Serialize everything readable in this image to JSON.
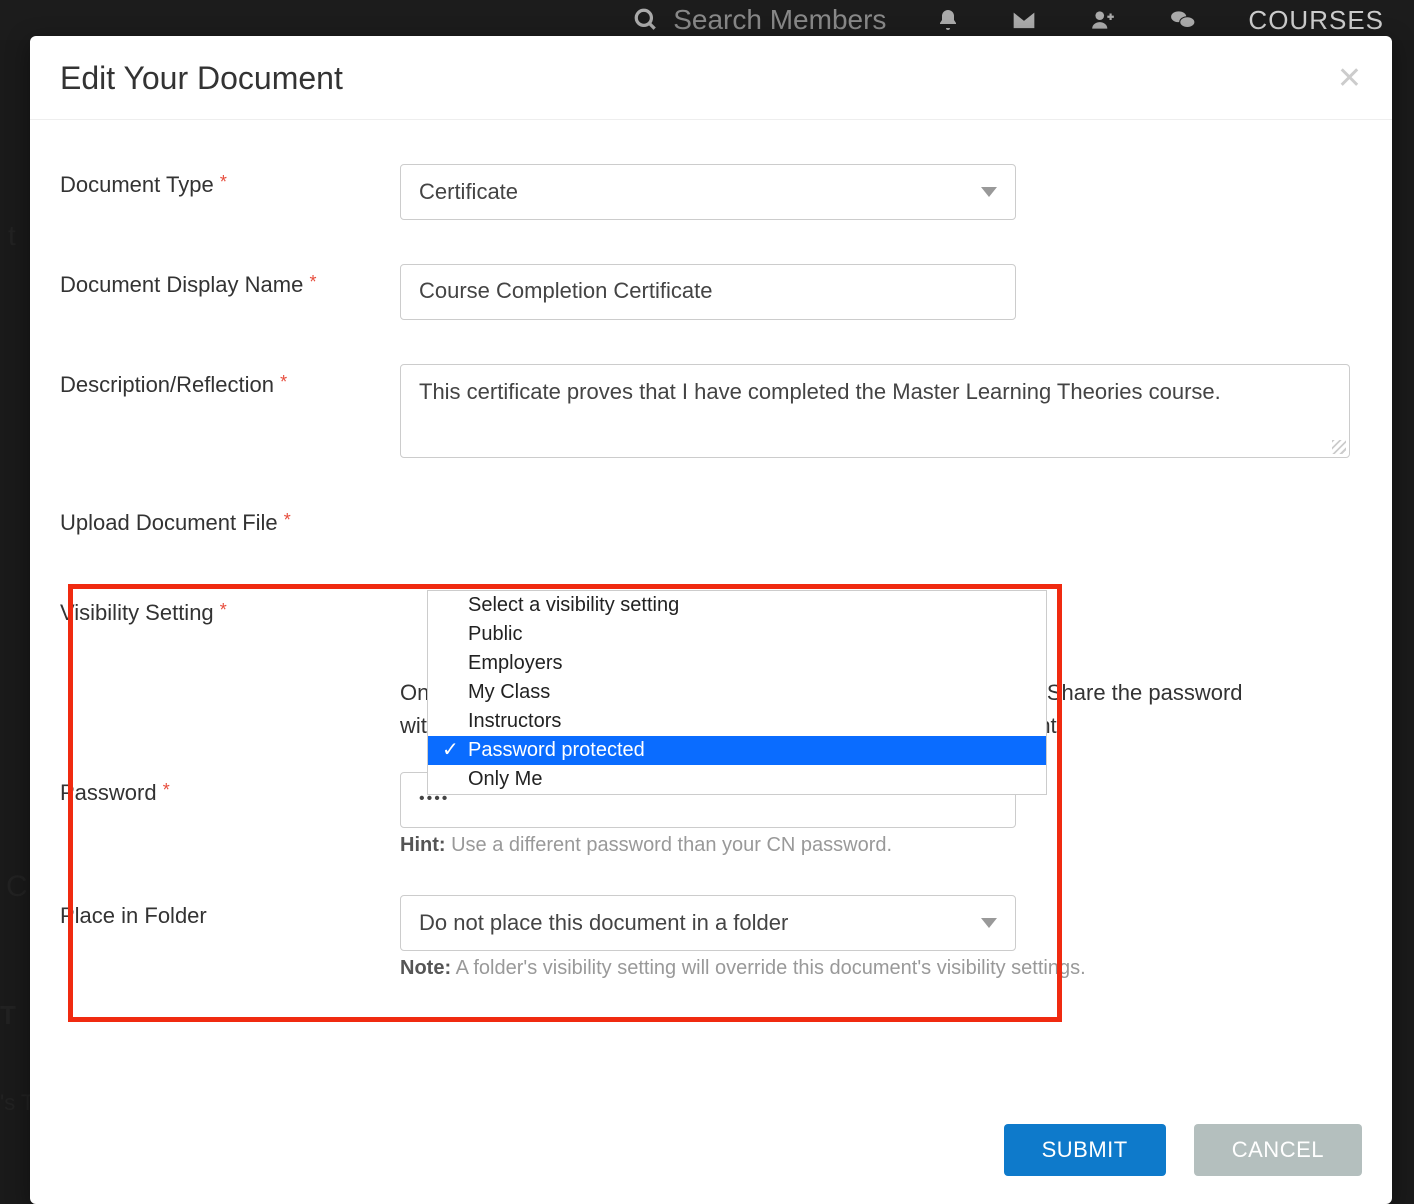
{
  "topnav": {
    "search_placeholder": "Search Members",
    "courses_label": "COURSES"
  },
  "modal": {
    "title": "Edit Your Document"
  },
  "form": {
    "doc_type": {
      "label": "Document Type",
      "value": "Certificate"
    },
    "display_name": {
      "label": "Document Display Name",
      "value": "Course Completion Certificate"
    },
    "description": {
      "label": "Description/Reflection",
      "value": "This certificate proves that I have completed the Master Learning Theories course."
    },
    "upload": {
      "label": "Upload Document File"
    },
    "visibility": {
      "label": "Visibility Setting",
      "options": [
        "Select a visibility setting",
        "Public",
        "Employers",
        "My Class",
        "Instructors",
        "Password protected",
        "Only Me"
      ],
      "selected_index": 5,
      "description": "Only users, with the password will be able to view your document. Share the password with people you would like to give permission to view this document."
    },
    "password": {
      "label": "Password",
      "value": "••••",
      "hint_label": "Hint:",
      "hint_text": "Use a different password than your CN password."
    },
    "folder": {
      "label": "Place in Folder",
      "value": "Do not place this document in a folder",
      "note_label": "Note:",
      "note_text": "A folder's visibility setting will override this document's visibility settings."
    }
  },
  "buttons": {
    "submit": "SUBMIT",
    "cancel": "CANCEL"
  },
  "bg": {
    "left_t": "t",
    "left_c": "C",
    "left_ts": "'s T",
    "left_T": "T"
  }
}
